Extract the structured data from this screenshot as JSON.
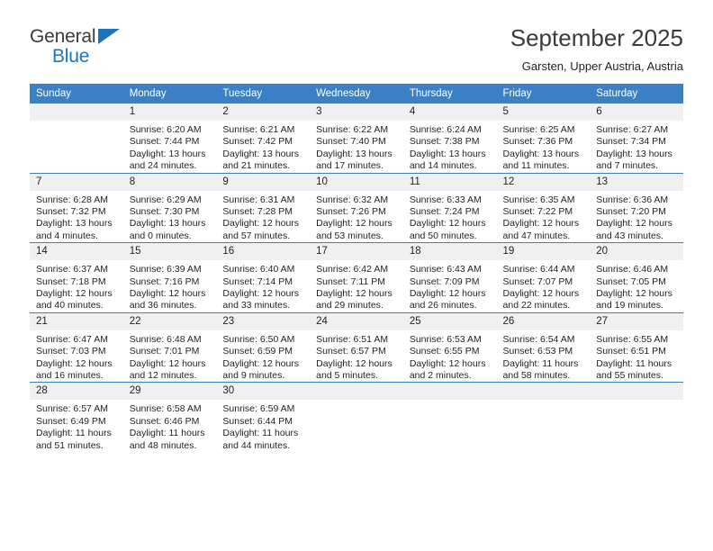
{
  "brand": {
    "name_dark": "General",
    "name_blue": "Blue",
    "accent_color": "#1b75bb"
  },
  "header": {
    "title": "September 2025",
    "subtitle": "Garsten, Upper Austria, Austria"
  },
  "theme": {
    "header_bar_color": "#3b7fc4",
    "daynum_band_color": "#f0f0f0",
    "text_color": "#231f20"
  },
  "weekdays": [
    "Sunday",
    "Monday",
    "Tuesday",
    "Wednesday",
    "Thursday",
    "Friday",
    "Saturday"
  ],
  "weeks": [
    [
      {
        "day": ""
      },
      {
        "day": "1",
        "sunrise": "Sunrise: 6:20 AM",
        "sunset": "Sunset: 7:44 PM",
        "daylight1": "Daylight: 13 hours",
        "daylight2": "and 24 minutes."
      },
      {
        "day": "2",
        "sunrise": "Sunrise: 6:21 AM",
        "sunset": "Sunset: 7:42 PM",
        "daylight1": "Daylight: 13 hours",
        "daylight2": "and 21 minutes."
      },
      {
        "day": "3",
        "sunrise": "Sunrise: 6:22 AM",
        "sunset": "Sunset: 7:40 PM",
        "daylight1": "Daylight: 13 hours",
        "daylight2": "and 17 minutes."
      },
      {
        "day": "4",
        "sunrise": "Sunrise: 6:24 AM",
        "sunset": "Sunset: 7:38 PM",
        "daylight1": "Daylight: 13 hours",
        "daylight2": "and 14 minutes."
      },
      {
        "day": "5",
        "sunrise": "Sunrise: 6:25 AM",
        "sunset": "Sunset: 7:36 PM",
        "daylight1": "Daylight: 13 hours",
        "daylight2": "and 11 minutes."
      },
      {
        "day": "6",
        "sunrise": "Sunrise: 6:27 AM",
        "sunset": "Sunset: 7:34 PM",
        "daylight1": "Daylight: 13 hours",
        "daylight2": "and 7 minutes."
      }
    ],
    [
      {
        "day": "7",
        "sunrise": "Sunrise: 6:28 AM",
        "sunset": "Sunset: 7:32 PM",
        "daylight1": "Daylight: 13 hours",
        "daylight2": "and 4 minutes."
      },
      {
        "day": "8",
        "sunrise": "Sunrise: 6:29 AM",
        "sunset": "Sunset: 7:30 PM",
        "daylight1": "Daylight: 13 hours",
        "daylight2": "and 0 minutes."
      },
      {
        "day": "9",
        "sunrise": "Sunrise: 6:31 AM",
        "sunset": "Sunset: 7:28 PM",
        "daylight1": "Daylight: 12 hours",
        "daylight2": "and 57 minutes."
      },
      {
        "day": "10",
        "sunrise": "Sunrise: 6:32 AM",
        "sunset": "Sunset: 7:26 PM",
        "daylight1": "Daylight: 12 hours",
        "daylight2": "and 53 minutes."
      },
      {
        "day": "11",
        "sunrise": "Sunrise: 6:33 AM",
        "sunset": "Sunset: 7:24 PM",
        "daylight1": "Daylight: 12 hours",
        "daylight2": "and 50 minutes."
      },
      {
        "day": "12",
        "sunrise": "Sunrise: 6:35 AM",
        "sunset": "Sunset: 7:22 PM",
        "daylight1": "Daylight: 12 hours",
        "daylight2": "and 47 minutes."
      },
      {
        "day": "13",
        "sunrise": "Sunrise: 6:36 AM",
        "sunset": "Sunset: 7:20 PM",
        "daylight1": "Daylight: 12 hours",
        "daylight2": "and 43 minutes."
      }
    ],
    [
      {
        "day": "14",
        "sunrise": "Sunrise: 6:37 AM",
        "sunset": "Sunset: 7:18 PM",
        "daylight1": "Daylight: 12 hours",
        "daylight2": "and 40 minutes."
      },
      {
        "day": "15",
        "sunrise": "Sunrise: 6:39 AM",
        "sunset": "Sunset: 7:16 PM",
        "daylight1": "Daylight: 12 hours",
        "daylight2": "and 36 minutes."
      },
      {
        "day": "16",
        "sunrise": "Sunrise: 6:40 AM",
        "sunset": "Sunset: 7:14 PM",
        "daylight1": "Daylight: 12 hours",
        "daylight2": "and 33 minutes."
      },
      {
        "day": "17",
        "sunrise": "Sunrise: 6:42 AM",
        "sunset": "Sunset: 7:11 PM",
        "daylight1": "Daylight: 12 hours",
        "daylight2": "and 29 minutes."
      },
      {
        "day": "18",
        "sunrise": "Sunrise: 6:43 AM",
        "sunset": "Sunset: 7:09 PM",
        "daylight1": "Daylight: 12 hours",
        "daylight2": "and 26 minutes."
      },
      {
        "day": "19",
        "sunrise": "Sunrise: 6:44 AM",
        "sunset": "Sunset: 7:07 PM",
        "daylight1": "Daylight: 12 hours",
        "daylight2": "and 22 minutes."
      },
      {
        "day": "20",
        "sunrise": "Sunrise: 6:46 AM",
        "sunset": "Sunset: 7:05 PM",
        "daylight1": "Daylight: 12 hours",
        "daylight2": "and 19 minutes."
      }
    ],
    [
      {
        "day": "21",
        "sunrise": "Sunrise: 6:47 AM",
        "sunset": "Sunset: 7:03 PM",
        "daylight1": "Daylight: 12 hours",
        "daylight2": "and 16 minutes."
      },
      {
        "day": "22",
        "sunrise": "Sunrise: 6:48 AM",
        "sunset": "Sunset: 7:01 PM",
        "daylight1": "Daylight: 12 hours",
        "daylight2": "and 12 minutes."
      },
      {
        "day": "23",
        "sunrise": "Sunrise: 6:50 AM",
        "sunset": "Sunset: 6:59 PM",
        "daylight1": "Daylight: 12 hours",
        "daylight2": "and 9 minutes."
      },
      {
        "day": "24",
        "sunrise": "Sunrise: 6:51 AM",
        "sunset": "Sunset: 6:57 PM",
        "daylight1": "Daylight: 12 hours",
        "daylight2": "and 5 minutes."
      },
      {
        "day": "25",
        "sunrise": "Sunrise: 6:53 AM",
        "sunset": "Sunset: 6:55 PM",
        "daylight1": "Daylight: 12 hours",
        "daylight2": "and 2 minutes."
      },
      {
        "day": "26",
        "sunrise": "Sunrise: 6:54 AM",
        "sunset": "Sunset: 6:53 PM",
        "daylight1": "Daylight: 11 hours",
        "daylight2": "and 58 minutes."
      },
      {
        "day": "27",
        "sunrise": "Sunrise: 6:55 AM",
        "sunset": "Sunset: 6:51 PM",
        "daylight1": "Daylight: 11 hours",
        "daylight2": "and 55 minutes."
      }
    ],
    [
      {
        "day": "28",
        "sunrise": "Sunrise: 6:57 AM",
        "sunset": "Sunset: 6:49 PM",
        "daylight1": "Daylight: 11 hours",
        "daylight2": "and 51 minutes."
      },
      {
        "day": "29",
        "sunrise": "Sunrise: 6:58 AM",
        "sunset": "Sunset: 6:46 PM",
        "daylight1": "Daylight: 11 hours",
        "daylight2": "and 48 minutes."
      },
      {
        "day": "30",
        "sunrise": "Sunrise: 6:59 AM",
        "sunset": "Sunset: 6:44 PM",
        "daylight1": "Daylight: 11 hours",
        "daylight2": "and 44 minutes."
      },
      {
        "day": ""
      },
      {
        "day": ""
      },
      {
        "day": ""
      },
      {
        "day": ""
      }
    ]
  ]
}
